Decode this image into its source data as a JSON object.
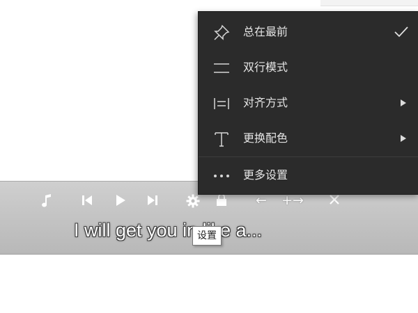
{
  "menu": {
    "items": [
      {
        "label": "总在最前",
        "icon": "pin-icon",
        "checked": true
      },
      {
        "label": "双行模式",
        "icon": "double-line-icon"
      },
      {
        "label": "对齐方式",
        "icon": "align-icon",
        "has_submenu": true
      },
      {
        "label": "更换配色",
        "icon": "text-color-icon",
        "has_submenu": true
      },
      {
        "label": "更多设置",
        "icon": "more-icon"
      }
    ]
  },
  "lyrics_bar": {
    "lyric_text": "I will get you in like a...",
    "tooltip": "设置",
    "controls": {
      "font_decrease": "←",
      "font_increase": "+→"
    }
  },
  "colors": {
    "menu_bg": "#2b2b2b",
    "bar_bg": "#c4c4c4",
    "text_white": "#ffffff"
  }
}
